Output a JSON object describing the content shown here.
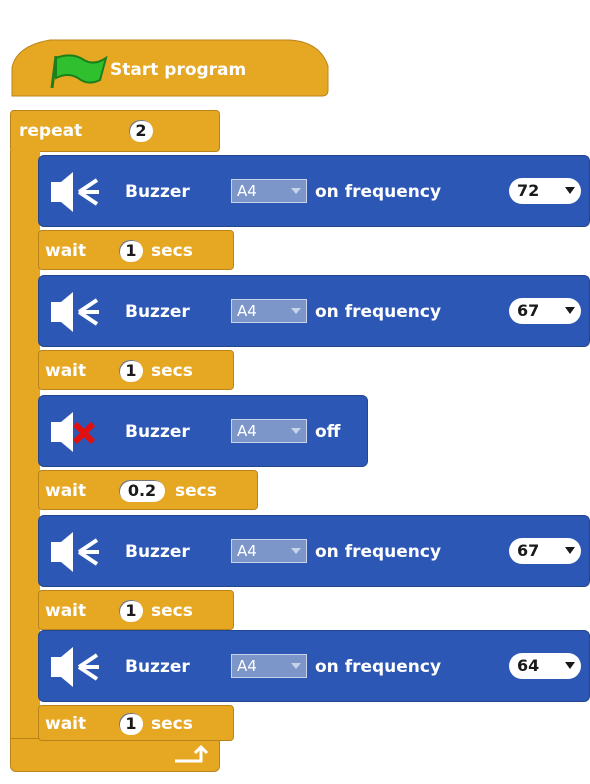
{
  "hat": {
    "label": "Start program",
    "icon": "green-flag-icon"
  },
  "repeat": {
    "label": "repeat",
    "count": "2"
  },
  "blocks": [
    {
      "type": "buzzer_on",
      "icon": "speaker-on-icon",
      "label": "Buzzer",
      "pin": "A4",
      "middle": "on frequency",
      "value": "72"
    },
    {
      "type": "wait",
      "prefix": "wait",
      "value": "1",
      "suffix": "secs"
    },
    {
      "type": "buzzer_on",
      "icon": "speaker-on-icon",
      "label": "Buzzer",
      "pin": "A4",
      "middle": "on frequency",
      "value": "67"
    },
    {
      "type": "wait",
      "prefix": "wait",
      "value": "1",
      "suffix": "secs"
    },
    {
      "type": "buzzer_off",
      "icon": "speaker-muted-icon",
      "label": "Buzzer",
      "pin": "A4",
      "middle": "off"
    },
    {
      "type": "wait",
      "prefix": "wait",
      "value": "0.2",
      "suffix": "secs"
    },
    {
      "type": "buzzer_on",
      "icon": "speaker-on-icon",
      "label": "Buzzer",
      "pin": "A4",
      "middle": "on frequency",
      "value": "67"
    },
    {
      "type": "wait",
      "prefix": "wait",
      "value": "1",
      "suffix": "secs"
    },
    {
      "type": "buzzer_on",
      "icon": "speaker-on-icon",
      "label": "Buzzer",
      "pin": "A4",
      "middle": "on frequency",
      "value": "64"
    },
    {
      "type": "wait",
      "prefix": "wait",
      "value": "1",
      "suffix": "secs"
    }
  ],
  "colors": {
    "control": "#e6a822",
    "robot": "#2d57b4",
    "flag": "#2fbf2f"
  }
}
